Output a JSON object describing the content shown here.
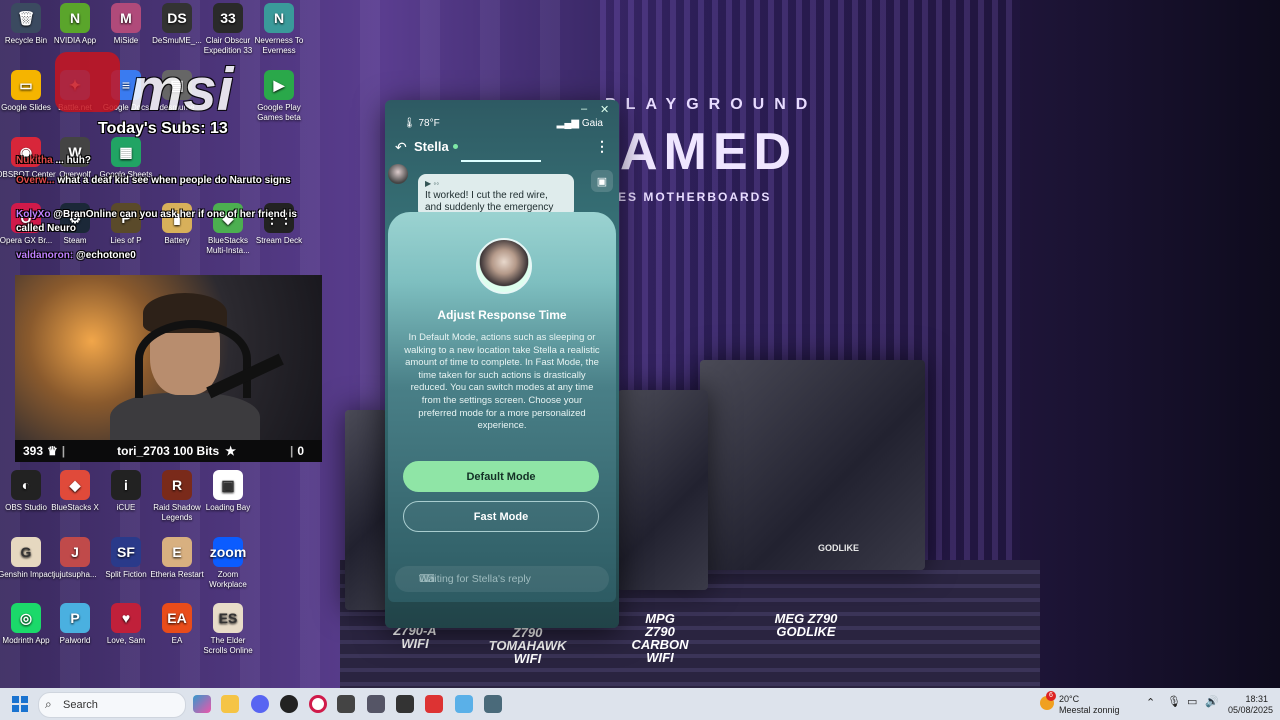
{
  "desktop": {
    "icons": [
      {
        "label": "Recycle Bin",
        "glyph": "🗑",
        "bg": "#3b4a60"
      },
      {
        "label": "NVIDIA App",
        "glyph": "N",
        "bg": "#5aa52b"
      },
      {
        "label": "MiSide",
        "glyph": "M",
        "bg": "#b04a7a"
      },
      {
        "label": "DeSmuME_...",
        "glyph": "DS",
        "bg": "#333"
      },
      {
        "label": "Clair Obscur Expedition 33",
        "glyph": "33",
        "bg": "#2a2a2a"
      },
      {
        "label": "Neverness To Everness",
        "glyph": "N",
        "bg": "#3a9a9a"
      },
      {
        "label": "Google Slides",
        "glyph": "▭",
        "bg": "#f5b400"
      },
      {
        "label": "Battle.net",
        "glyph": "✦",
        "bg": "#148eff"
      },
      {
        "label": "Google Docs",
        "glyph": "≡",
        "bg": "#3a7bf0"
      },
      {
        "label": "desmume",
        "glyph": "▤",
        "bg": "#666"
      },
      {
        "label": "Google Play Games beta",
        "glyph": "▶",
        "bg": "#2aa84a"
      },
      {
        "label": "OBSBOT Center",
        "glyph": "◉",
        "bg": "#d8263a"
      },
      {
        "label": "Overwolf",
        "glyph": "W",
        "bg": "#444"
      },
      {
        "label": "Google Sheets",
        "glyph": "▦",
        "bg": "#21a464"
      },
      {
        "label": "Battery",
        "glyph": "▮",
        "bg": "#d8b05a"
      },
      {
        "label": "BlueStacks Multi-Insta...",
        "glyph": "◆",
        "bg": "#4caf50"
      },
      {
        "label": "Stream Deck",
        "glyph": "⋮⋮",
        "bg": "#222"
      },
      {
        "label": "Opera GX Br...",
        "glyph": "O",
        "bg": "#d01a4a"
      },
      {
        "label": "Steam",
        "glyph": "⚙",
        "bg": "#1b2838"
      },
      {
        "label": "Lies of P",
        "glyph": "P",
        "bg": "#5a4a2a"
      },
      {
        "label": "OBS Studio",
        "glyph": "◐",
        "bg": "#222"
      },
      {
        "label": "BlueStacks X",
        "glyph": "◆",
        "bg": "#e04a3a"
      },
      {
        "label": "iCUE",
        "glyph": "i",
        "bg": "#222"
      },
      {
        "label": "Raid Shadow Legends",
        "glyph": "R",
        "bg": "#7a2a1a"
      },
      {
        "label": "Loading Bay",
        "glyph": "▣",
        "bg": "#fff"
      },
      {
        "label": "Genshin Impact",
        "glyph": "G",
        "bg": "#e6d8c0"
      },
      {
        "label": "jujutsupha...",
        "glyph": "J",
        "bg": "#c04a4a"
      },
      {
        "label": "Split Fiction",
        "glyph": "SF",
        "bg": "#2a3a8a"
      },
      {
        "label": "Etheria Restart",
        "glyph": "E",
        "bg": "#d8b080"
      },
      {
        "label": "Zoom Workplace",
        "glyph": "zoom",
        "bg": "#0b5cff"
      },
      {
        "label": "Modrinth App",
        "glyph": "◎",
        "bg": "#1bd96a"
      },
      {
        "label": "Palworld",
        "glyph": "P",
        "bg": "#4ab0e0"
      },
      {
        "label": "Love, Sam",
        "glyph": "♥",
        "bg": "#c0203a"
      },
      {
        "label": "EA",
        "glyph": "EA",
        "bg": "#e94c1a"
      },
      {
        "label": "The Elder Scrolls Online",
        "glyph": "ES",
        "bg": "#e8dcc8"
      }
    ]
  },
  "stream_overlay": {
    "subs": "Today's Subs: 13",
    "chat": [
      {
        "user": "Nukitha",
        "text": "... huh?",
        "color": "#e04a4a"
      },
      {
        "user": "Overw...",
        "text": "what a deaf kid see when people do Naruto signs",
        "color": "#e04a4a"
      },
      {
        "user": "KolyXo",
        "text": "@BranOnline can you ask her if one of her friend is called Neuro",
        "color": "#c080ff"
      },
      {
        "user": "valdanoron:",
        "text": "@echotone0",
        "color": "#c080ff"
      }
    ],
    "bits_count": "393",
    "bits_text": "tori_2703 100 Bits",
    "bits_right": "0"
  },
  "wallpaper": {
    "line1": "PLAYGROUND",
    "line2": "AMED",
    "line3": "ES MOTHERBOARDS",
    "products": [
      "Z790-A WIFI",
      "Z790 TOMAHAWK WIFI",
      "MPG Z790 CARBON WIFI",
      "MEG Z790 GODLIKE"
    ],
    "board_label": "GODLIKE"
  },
  "app": {
    "temp": "78°F",
    "carrier": "Gaia",
    "contact_name": "Stella",
    "message": "It worked! I cut the red wire, and suddenly the emergency",
    "modal": {
      "title": "Adjust Response Time",
      "body": "In Default Mode, actions such as sleeping or walking to a new location take Stella a realistic amount of time to complete. In Fast Mode, the time taken for such actions is drastically reduced. You can switch modes at any time from the settings screen. Choose your preferred mode for a more personalized experience.",
      "primary_btn": "Default Mode",
      "secondary_btn": "Fast Mode"
    },
    "waiting": "Waiting for Stella's reply"
  },
  "taskbar": {
    "search": "Search",
    "weather_temp": "20°C",
    "weather_desc": "Meestal zonnig",
    "weather_badge": "6",
    "time": "18:31",
    "date": "05/08/2025"
  }
}
